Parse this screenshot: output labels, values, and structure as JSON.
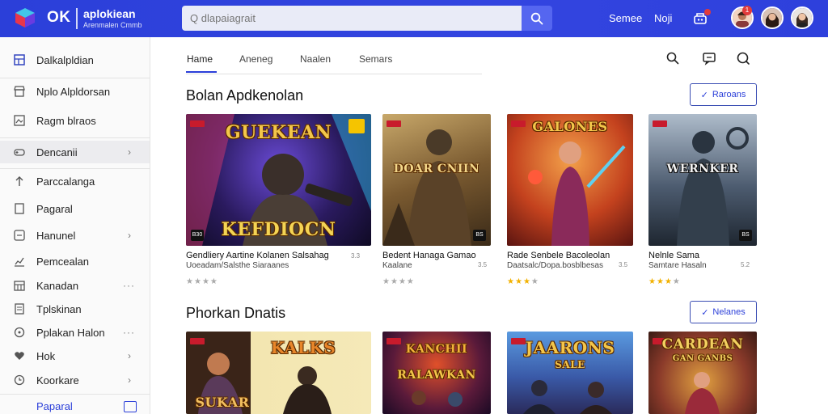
{
  "header": {
    "logo_text": "OK",
    "brand_name": "aplokiean",
    "brand_sub": "Arenmalen Cmmb",
    "search_placeholder": "Q dlapaiagrait",
    "nav_links": [
      "Semee",
      "Noji"
    ],
    "avatar_badge": "1",
    "colors": {
      "bar": "#2b3fd9",
      "search_button": "#5566f0",
      "badge": "#e23b3b"
    }
  },
  "sidebar": {
    "items": [
      {
        "label": "Dalkalpldian",
        "icon": "grid-icon"
      },
      {
        "label": "Nplo Alpldorsan",
        "icon": "store-icon"
      },
      {
        "label": "Ragm blraos",
        "icon": "image-icon"
      },
      {
        "label": "Dencanii",
        "icon": "controller-icon",
        "chevron": "›",
        "active": true
      },
      {
        "label": "Parccalanga",
        "icon": "arrow-up-icon"
      },
      {
        "label": "Pagaral",
        "icon": "file-icon"
      },
      {
        "label": "Hanunel",
        "icon": "box-icon",
        "chevron": "›"
      },
      {
        "label": "Pemcealan",
        "icon": "chart-icon"
      },
      {
        "label": "Kanadan",
        "icon": "table-icon",
        "dots": "···"
      },
      {
        "label": "Tplskinan",
        "icon": "doc-icon"
      },
      {
        "label": "Pplakan Halon",
        "icon": "circle-icon",
        "dots": "···"
      },
      {
        "label": "Hok",
        "icon": "heart-icon",
        "chevron": "›"
      },
      {
        "label": "Koorkare",
        "icon": "clock-icon",
        "chevron": "›"
      }
    ],
    "bottom_label": "Paparal"
  },
  "tabs": [
    "Hame",
    "Aneneg",
    "Naalen",
    "Semars"
  ],
  "toolbar_icons": [
    "search-icon",
    "message-icon",
    "search-alt-icon"
  ],
  "sections": [
    {
      "title": "Bolan Apdkenolan",
      "button_label": "Raroans",
      "cards": [
        {
          "art_title": "GUEKEAN",
          "art_title2": "KEFDIOCN",
          "corner": "B30",
          "title": "Gendliery Aartine Kolanen Salsahag",
          "sub": "Uoeadam/Salsthe Siaraanes",
          "side": "3.3",
          "rating": 0
        },
        {
          "art_title": "DOAR CNIIN",
          "art_title2": "",
          "corner": "BS",
          "title": "Bedent Hanaga Gamao",
          "sub": "Kaalane",
          "side": "3.5",
          "rating": 0
        },
        {
          "art_title": "GALONES",
          "art_title2": "",
          "corner": "",
          "title": "Rade Senbele Bacoleolan",
          "sub": "Daatsalc/Dopa.bosblbesas",
          "side": "3.5",
          "rating": 3
        },
        {
          "art_title": "WERNKER",
          "art_title2": "",
          "corner": "BS",
          "title": "Nelnle Sama",
          "sub": "Samtare Hasaln",
          "side": "5.2",
          "rating": 3
        }
      ]
    },
    {
      "title": "Phorkan Dnatis",
      "button_label": "Nelanes",
      "cards": [
        {
          "art_title": "KALKS",
          "art_title2": "SUKAR"
        },
        {
          "art_title": "KANCHII",
          "art_title2": "RALAWKAN"
        },
        {
          "art_title": "JAARONS",
          "art_title2": "SALE"
        },
        {
          "art_title": "CARDEAN",
          "art_title2": "GAN GANBS"
        }
      ]
    }
  ]
}
